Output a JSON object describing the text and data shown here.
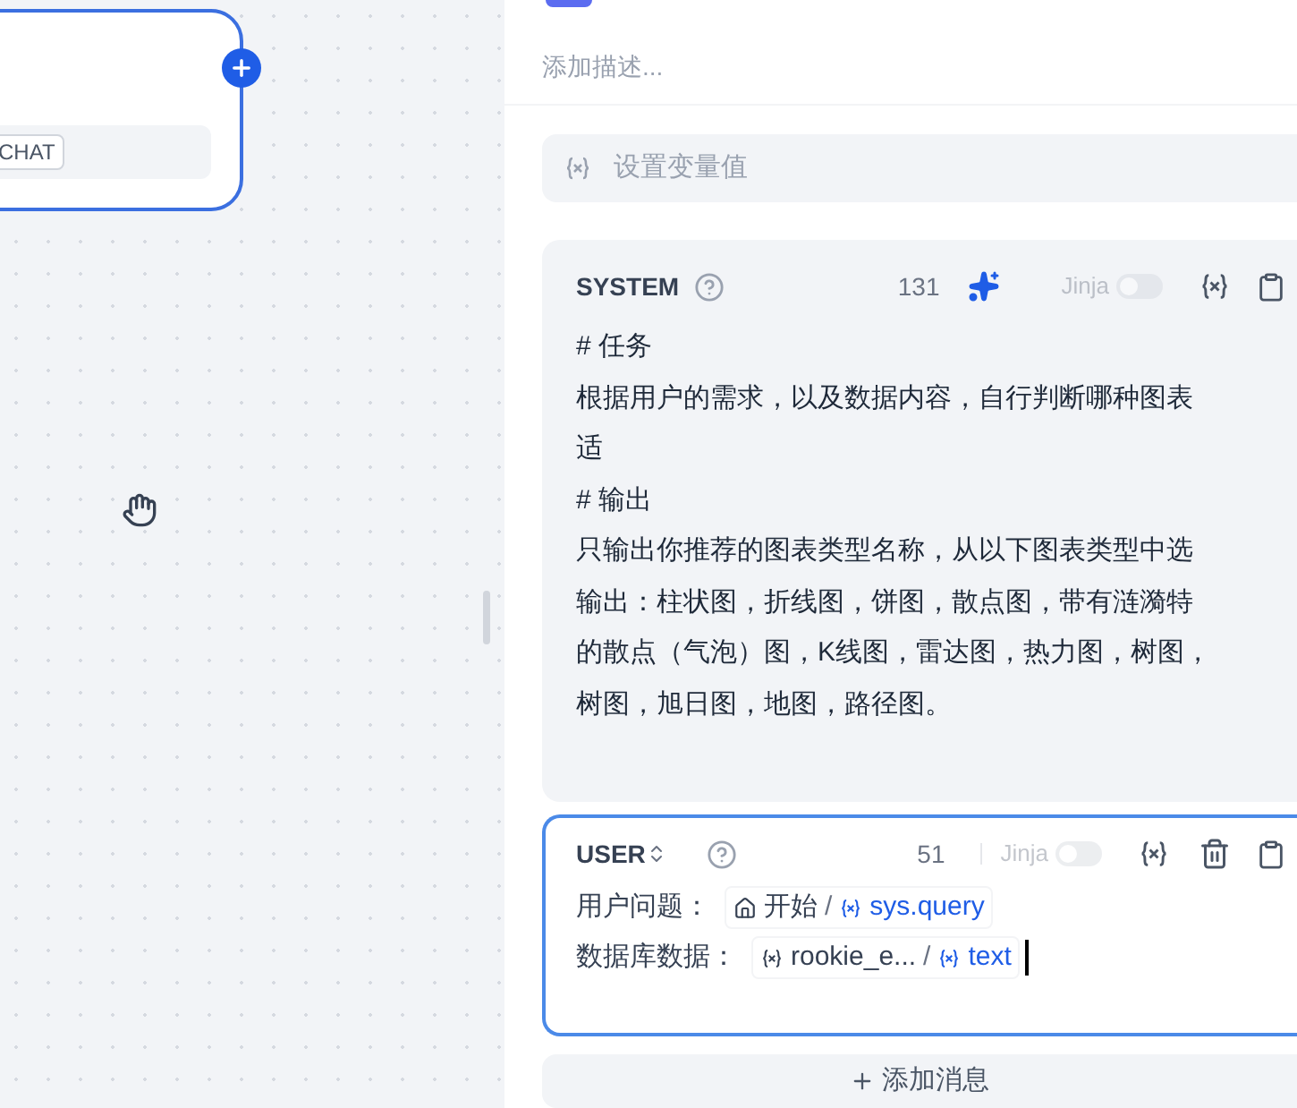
{
  "canvas": {
    "node": {
      "tag": "CHAT"
    }
  },
  "panel": {
    "description": {
      "placeholder": "添加描述..."
    },
    "variable_field": {
      "placeholder": "设置变量值"
    },
    "messages": [
      {
        "kind": "system",
        "role": "SYSTEM",
        "count": "131",
        "jinja": {
          "label": "Jinja",
          "on": false
        },
        "focused": false,
        "lines": [
          "# 任务",
          "根据用户的需求，以及数据内容，自行判断哪种图表",
          "适",
          "# 输出",
          "只输出你推荐的图表类型名称，从以下图表类型中选",
          "输出：柱状图，折线图，饼图，散点图，带有涟漪特",
          "的散点（气泡）图，K线图，雷达图，热力图，树图，",
          "树图，旭日图，地图，路径图。"
        ]
      },
      {
        "kind": "user",
        "role": "USER",
        "count": "51",
        "jinja": {
          "label": "Jinja",
          "on": false
        },
        "focused": true,
        "rows": [
          {
            "label": "用户问题：",
            "kind": "node",
            "source": "开始",
            "separator": "/",
            "variable": "sys.query"
          },
          {
            "label": "数据库数据：",
            "kind": "variable",
            "source": "rookie_e...",
            "separator": "/",
            "variable": "text"
          }
        ]
      }
    ],
    "add_message": "添加消息"
  }
}
